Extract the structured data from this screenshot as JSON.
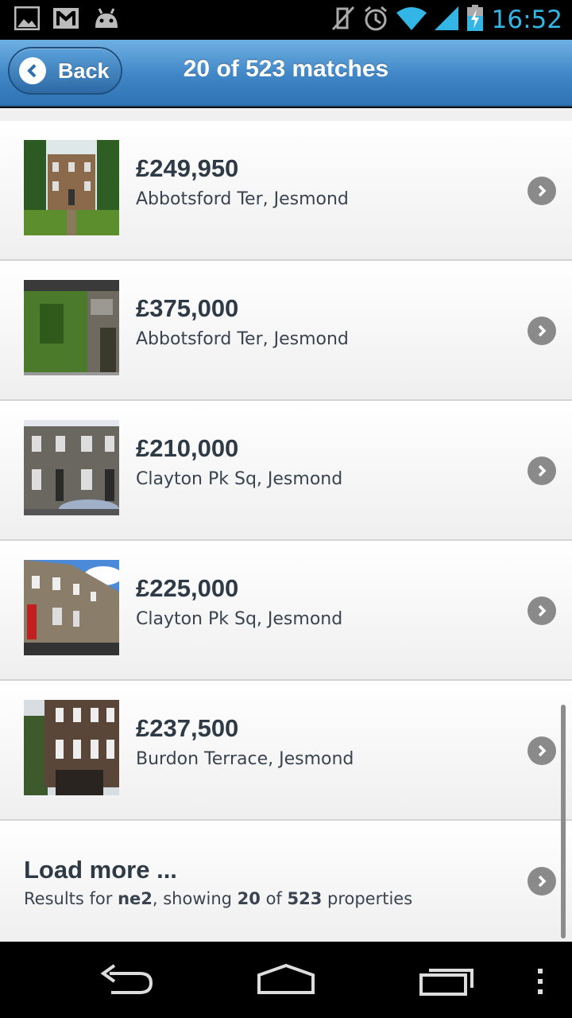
{
  "status_bar": {
    "time": "16:52",
    "left_icons": [
      "gallery-icon",
      "gmail-icon",
      "android-icon"
    ],
    "right_icons": [
      "mute-icon",
      "alarm-icon",
      "wifi-icon",
      "signal-icon",
      "battery-charging-icon"
    ],
    "accent_color": "#33b5e5"
  },
  "header": {
    "back_label": "Back",
    "title": "20 of 523 matches",
    "color": "#3f86c7"
  },
  "listings": [
    {
      "price": "£249,950",
      "address": "Abbotsford Ter, Jesmond"
    },
    {
      "price": "£375,000",
      "address": "Abbotsford Ter, Jesmond"
    },
    {
      "price": "£210,000",
      "address": "Clayton Pk Sq, Jesmond"
    },
    {
      "price": "£225,000",
      "address": "Clayton Pk Sq, Jesmond"
    },
    {
      "price": "£237,500",
      "address": "Burdon Terrace, Jesmond"
    }
  ],
  "load_more": {
    "title": "Load more ...",
    "sub_prefix": "Results for ",
    "query": "ne2",
    "sub_middle": ", showing ",
    "shown": "20",
    "sub_of": " of ",
    "total": "523",
    "sub_suffix": " properties"
  },
  "nav_bar": {
    "icons": [
      "back-nav-icon",
      "home-nav-icon",
      "recent-apps-icon",
      "overflow-menu-icon"
    ]
  }
}
